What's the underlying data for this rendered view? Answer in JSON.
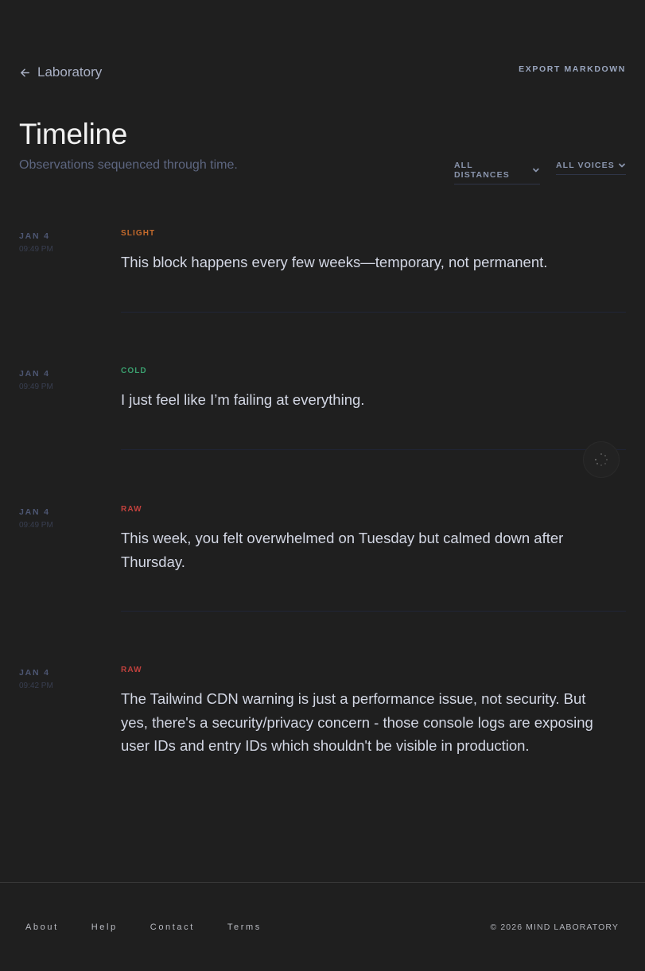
{
  "header": {
    "back_label": "Laboratory",
    "export_label": "EXPORT MARKDOWN",
    "title": "Timeline",
    "subtitle": "Observations sequenced through time."
  },
  "filters": {
    "distances": "ALL DISTANCES",
    "voices": "ALL VOICES"
  },
  "entries": [
    {
      "date": "JAN 4",
      "time": "09:49 PM",
      "tag": "SLIGHT",
      "tag_color": "#c46a2c",
      "text": "This block happens every few weeks—temporary, not permanent."
    },
    {
      "date": "JAN 4",
      "time": "09:49 PM",
      "tag": "COLD",
      "tag_color": "#3a9e6e",
      "text": "I just feel like I’m failing at everything."
    },
    {
      "date": "JAN 4",
      "time": "09:49 PM",
      "tag": "RAW",
      "tag_color": "#c0413d",
      "text": "This week, you felt overwhelmed on Tuesday but calmed down after Thursday."
    },
    {
      "date": "JAN 4",
      "time": "09:42 PM",
      "tag": "RAW",
      "tag_color": "#c0413d",
      "text": "The Tailwind CDN warning is just a performance issue, not security. But yes, there's a security/privacy concern - those console logs are exposing user IDs and entry IDs which shouldn't be visible in production."
    }
  ],
  "loader_icon": "loading-spinner-icon",
  "footer": {
    "links": [
      "About",
      "Help",
      "Contact",
      "Terms"
    ],
    "copyright": "© 2026 MIND LABORATORY"
  },
  "colors": {
    "background": "#1f1f1f",
    "slight": "#c46a2c",
    "cold": "#3a9e6e",
    "raw": "#c0413d"
  }
}
